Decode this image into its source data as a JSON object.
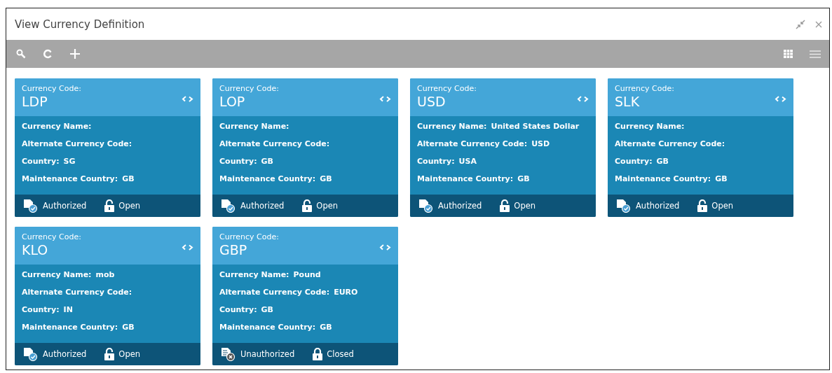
{
  "window": {
    "title": "View Currency Definition"
  },
  "cards": [
    {
      "code_label": "Currency Code:",
      "code": "LDP",
      "fields": [
        {
          "label": "Currency Name:"
        },
        {
          "label": "Alternate Currency Code:"
        },
        {
          "label": "Country:",
          "value": "SG"
        },
        {
          "label": "Maintenance Country:",
          "value": "GB"
        }
      ],
      "authorization": {
        "kind": "authorized",
        "label": "Authorized"
      },
      "record": {
        "kind": "open",
        "label": "Open"
      }
    },
    {
      "code_label": "Currency Code:",
      "code": "LOP",
      "fields": [
        {
          "label": "Currency Name:"
        },
        {
          "label": "Alternate Currency Code:"
        },
        {
          "label": "Country:",
          "value": "GB"
        },
        {
          "label": "Maintenance Country:",
          "value": "GB"
        }
      ],
      "authorization": {
        "kind": "authorized",
        "label": "Authorized"
      },
      "record": {
        "kind": "open",
        "label": "Open"
      }
    },
    {
      "code_label": "Currency Code:",
      "code": "USD",
      "fields": [
        {
          "label": "Currency Name:",
          "value": "United States Dollar"
        },
        {
          "label": "Alternate Currency Code:",
          "value": "USD"
        },
        {
          "label": "Country:",
          "value": "USA"
        },
        {
          "label": "Maintenance Country:",
          "value": "GB"
        }
      ],
      "authorization": {
        "kind": "authorized",
        "label": "Authorized"
      },
      "record": {
        "kind": "open",
        "label": "Open"
      }
    },
    {
      "code_label": "Currency Code:",
      "code": "SLK",
      "fields": [
        {
          "label": "Currency Name:"
        },
        {
          "label": "Alternate Currency Code:"
        },
        {
          "label": "Country:",
          "value": "GB"
        },
        {
          "label": "Maintenance Country:",
          "value": "GB"
        }
      ],
      "authorization": {
        "kind": "authorized",
        "label": "Authorized"
      },
      "record": {
        "kind": "open",
        "label": "Open"
      }
    },
    {
      "code_label": "Currency Code:",
      "code": "KLO",
      "fields": [
        {
          "label": "Currency Name:",
          "value": "mob"
        },
        {
          "label": "Alternate Currency Code:"
        },
        {
          "label": "Country:",
          "value": "IN"
        },
        {
          "label": "Maintenance Country:",
          "value": "GB"
        }
      ],
      "authorization": {
        "kind": "authorized",
        "label": "Authorized"
      },
      "record": {
        "kind": "open",
        "label": "Open"
      }
    },
    {
      "code_label": "Currency Code:",
      "code": "GBP",
      "fields": [
        {
          "label": "Currency Name:",
          "value": "Pound"
        },
        {
          "label": "Alternate Currency Code:",
          "value": "EURO"
        },
        {
          "label": "Country:",
          "value": "GB"
        },
        {
          "label": "Maintenance Country:",
          "value": "GB"
        }
      ],
      "authorization": {
        "kind": "unauthorized",
        "label": "Unauthorized"
      },
      "record": {
        "kind": "closed",
        "label": "Closed"
      }
    }
  ]
}
